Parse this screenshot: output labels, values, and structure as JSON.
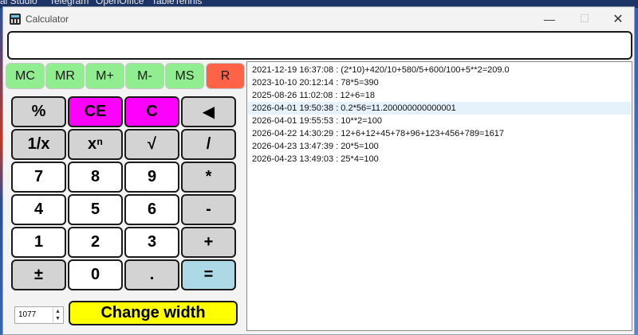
{
  "desktop": {
    "taskbar_labels": [
      "al Studio",
      "Telegram",
      "OpenOffice",
      "TableTennis"
    ]
  },
  "window": {
    "title": "Calculator",
    "min_glyph": "—",
    "max_glyph": "☐",
    "close_glyph": "✕"
  },
  "display": {
    "value": ""
  },
  "memory": [
    "MC",
    "MR",
    "M+",
    "M-",
    "MS",
    "R"
  ],
  "keypad": [
    [
      "%",
      "CE",
      "C",
      "◀"
    ],
    [
      "1/x",
      "xⁿ",
      "√",
      "/"
    ],
    [
      "7",
      "8",
      "9",
      "*"
    ],
    [
      "4",
      "5",
      "6",
      "-"
    ],
    [
      "1",
      "2",
      "3",
      "+"
    ],
    [
      "±",
      "0",
      ".",
      "="
    ]
  ],
  "width_control": {
    "value": "1077",
    "up": "▲",
    "down": "▼",
    "button_label": "Change width"
  },
  "history": [
    "2021-12-19 16:37:08 : (2*10)+420/10+580/5+600/100+5**2=209.0",
    "2023-10-10 20:12:14 : 78*5=390",
    "2025-08-26 11:02:08 : 12+6=18",
    "2026-04-01 19:50:38 : 0.2*56=11.200000000000001",
    "2026-04-01 19:55:53 : 10**2=100",
    "2026-04-22 14:30:29 : 12+6+12+45+78+96+123+456+789=1617",
    "2026-04-23 13:47:39 : 20*5=100",
    "2026-04-23 13:49:03 : 25*4=100"
  ],
  "history_selected_index": 3,
  "colors": {
    "memory_button": "#90ee90",
    "reset_button": "#ff6347",
    "key_default": "#d3d3d3",
    "key_clear": "#ff00ff",
    "key_digit": "#ffffff",
    "key_equals": "#add8e6",
    "change_width_button": "#ffff00"
  }
}
